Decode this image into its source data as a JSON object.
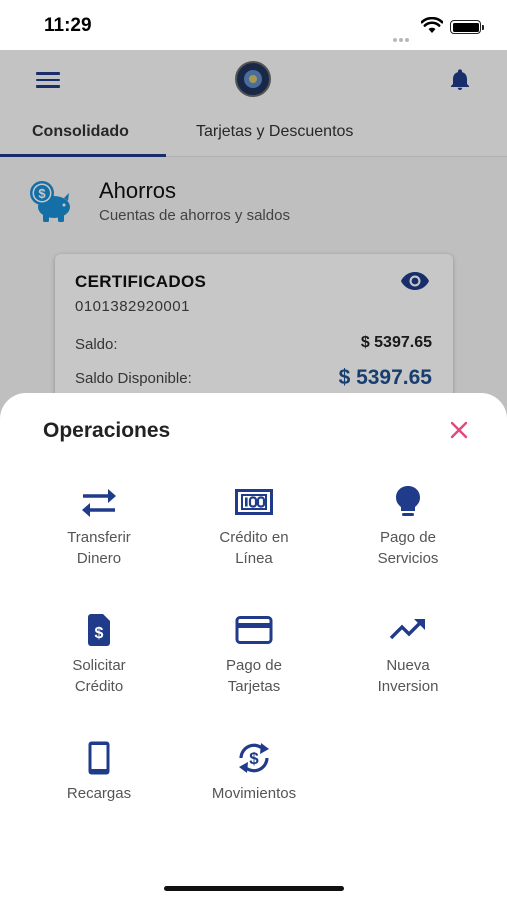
{
  "status_bar": {
    "time": "11:29"
  },
  "header": {
    "logo": "institution-seal-logo",
    "menu_icon": "hamburger-icon",
    "notification_icon": "bell-icon"
  },
  "tabs": [
    {
      "label": "Consolidado",
      "active": true
    },
    {
      "label": "Tarjetas y Descuentos",
      "active": false
    }
  ],
  "section": {
    "icon": "piggy-bank-icon",
    "title": "Ahorros",
    "subtitle": "Cuentas de ahorros y saldos"
  },
  "account_card": {
    "title": "CERTIFICADOS",
    "account_number": "0101382920001",
    "balance_label": "Saldo:",
    "balance_value": "$ 5397.65",
    "available_label": "Saldo Disponible:",
    "available_value": "$ 5397.65",
    "visibility_icon": "eye-icon"
  },
  "operations_sheet": {
    "title": "Operaciones",
    "close_icon": "close-icon",
    "items": [
      {
        "line1": "Transferir",
        "line2": "Dinero",
        "icon": "transfer-arrows-icon"
      },
      {
        "line1": "Crédito en",
        "line2": "Línea",
        "icon": "money-bill-icon"
      },
      {
        "line1": "Pago de",
        "line2": "Servicios",
        "icon": "lightbulb-icon"
      },
      {
        "line1": "Solicitar",
        "line2": "Crédito",
        "icon": "dollar-document-icon"
      },
      {
        "line1": "Pago de",
        "line2": "Tarjetas",
        "icon": "credit-card-icon"
      },
      {
        "line1": "Nueva",
        "line2": "Inversion",
        "icon": "trending-up-icon"
      },
      {
        "line1": "Recargas",
        "line2": "",
        "icon": "smartphone-icon"
      },
      {
        "line1": "Movimientos",
        "line2": "",
        "icon": "dollar-refresh-icon"
      }
    ]
  },
  "colors": {
    "primary": "#1f3b8a",
    "close_accent": "#e04a7a",
    "balance_accent": "#1f4f8f",
    "piggy": "#1a8fd6"
  }
}
